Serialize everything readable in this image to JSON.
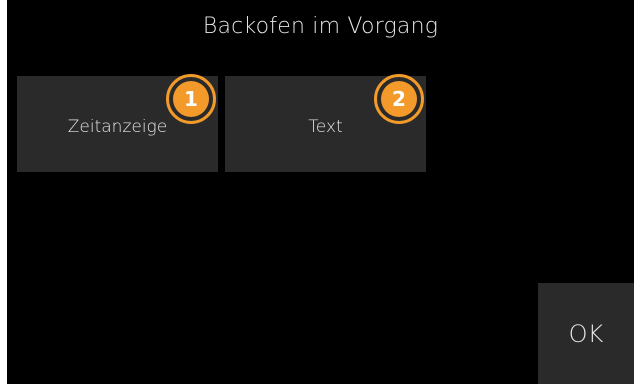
{
  "screen": {
    "title": "Backofen im Vorgang"
  },
  "tiles": [
    {
      "label": "Zeitanzeige",
      "badge": "1"
    },
    {
      "label": "Text",
      "badge": "2"
    }
  ],
  "ok_button": {
    "label": "OK"
  },
  "colors": {
    "background": "#000000",
    "tile": "#2a2a2a",
    "text": "#e6e6e6",
    "badge": "#f39a2b"
  }
}
